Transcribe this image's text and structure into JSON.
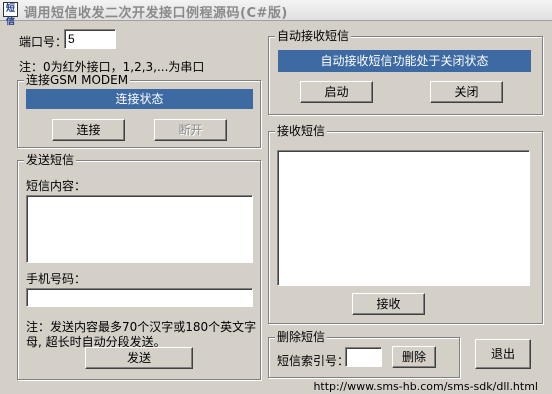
{
  "window": {
    "app_icon": "短信",
    "title": "调用短信收发二次开发接口例程源码(C#版)"
  },
  "port": {
    "label": "端口号：",
    "value": "5",
    "note": "注：0为红外接口，1,2,3,...为串口"
  },
  "connect": {
    "legend": "连接GSM MODEM",
    "status": "连接状态",
    "connect_label": "连接",
    "disconnect_label": "断开"
  },
  "auto_receive": {
    "legend": "自动接收短信",
    "status": "自动接收短信功能处于关闭状态",
    "enable_label": "启动",
    "close_label": "关闭"
  },
  "send": {
    "legend": "发送短信",
    "content_label": "短信内容：",
    "content_value": "",
    "phone_label": "手机号码：",
    "phone_value": "",
    "note_line1": "注：发送内容最多70个汉字或180个英文字",
    "note_line2": "母, 超长时自动分段发送。",
    "send_label": "发送"
  },
  "receive": {
    "legend": "接收短信",
    "content_value": "",
    "receive_label": "接收"
  },
  "delete": {
    "legend": "删除短信",
    "index_label": "短信索引号：",
    "index_value": "",
    "delete_label": "删除"
  },
  "exit_label": "退出",
  "footer_url": "http://www.sms-hb.com/sms-sdk/dll.html"
}
